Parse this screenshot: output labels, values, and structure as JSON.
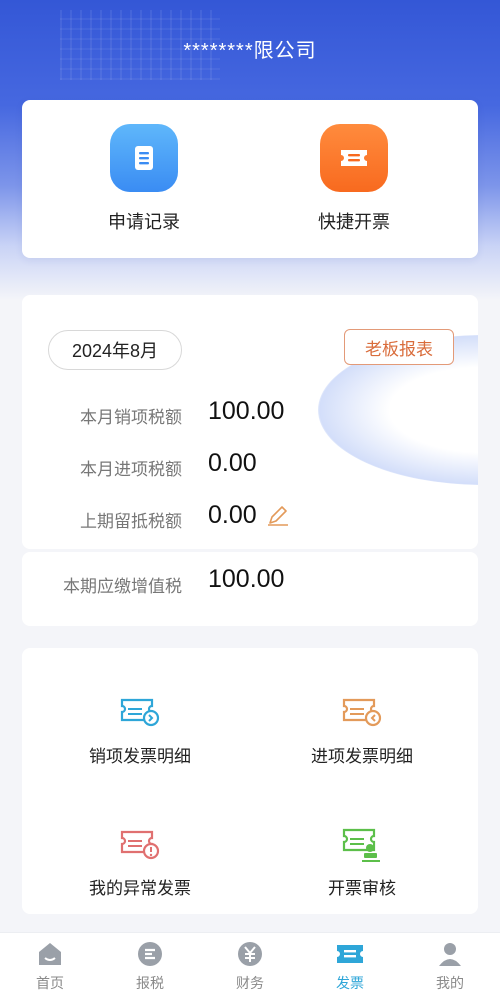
{
  "header": {
    "company_name": "********限公司"
  },
  "quick_actions": [
    {
      "label": "申请记录",
      "icon": "document-list-icon",
      "color": "#3a8cf3"
    },
    {
      "label": "快捷开票",
      "icon": "ticket-icon",
      "color": "#f86a1f"
    }
  ],
  "tax_summary": {
    "month": "2024年8月",
    "boss_report_label": "老板报表",
    "rows": [
      {
        "label": "本月销项税额",
        "value": "100.00"
      },
      {
        "label": "本月进项税额",
        "value": "0.00"
      },
      {
        "label": "上期留抵税额",
        "value": "0.00",
        "editable": true
      }
    ],
    "vat_due": {
      "label": "本期应缴增值税",
      "value": "100.00"
    }
  },
  "grid_menu": [
    {
      "label": "销项发票明细",
      "icon": "outgoing-invoice-icon",
      "color": "#2ea6d8"
    },
    {
      "label": "进项发票明细",
      "icon": "incoming-invoice-icon",
      "color": "#e39a5a"
    },
    {
      "label": "我的异常发票",
      "icon": "invoice-warning-icon",
      "color": "#e07070"
    },
    {
      "label": "开票审核",
      "icon": "invoice-review-icon",
      "color": "#5cbf4a"
    }
  ],
  "tabbar": [
    {
      "label": "首页",
      "icon": "home-icon",
      "active": false
    },
    {
      "label": "报税",
      "icon": "tax-report-icon",
      "active": false
    },
    {
      "label": "财务",
      "icon": "yen-icon",
      "active": false
    },
    {
      "label": "发票",
      "icon": "invoice-tab-icon",
      "active": true
    },
    {
      "label": "我的",
      "icon": "profile-icon",
      "active": false
    }
  ],
  "colors": {
    "brand_blue": "#3457d6",
    "active_tab": "#2ea6d8",
    "accent_orange": "#d96c3b"
  }
}
